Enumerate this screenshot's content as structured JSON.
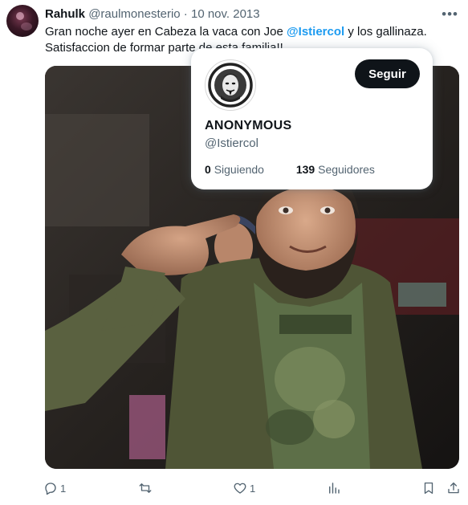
{
  "tweet": {
    "author_name": "Rahulk",
    "author_handle": "@raulmonesterio",
    "separator": " · ",
    "date": "10 nov. 2013",
    "text_part1": "Gran noche ayer en Cabeza la vaca con Joe ",
    "mention": "@Istiercol",
    "text_part2": " y los gallinaza.",
    "text_line2": "Satisfaccion de formar parte de esta familia!!"
  },
  "hover_card": {
    "display_name": "ANONYMOUS",
    "handle": "@Istiercol",
    "follow_label": "Seguir",
    "following_count": "0",
    "following_label": "Siguiendo",
    "followers_count": "139",
    "followers_label": "Seguidores"
  },
  "actions": {
    "replies": "1",
    "retweets": "",
    "likes": "1",
    "views": ""
  },
  "icons": [
    "more-icon",
    "reply-icon",
    "retweet-icon",
    "like-icon",
    "views-icon",
    "bookmark-icon",
    "share-icon"
  ],
  "colors": {
    "accent": "#1d9bf0",
    "text": "#0f1419",
    "muted": "#536471",
    "button": "#0f1419"
  }
}
